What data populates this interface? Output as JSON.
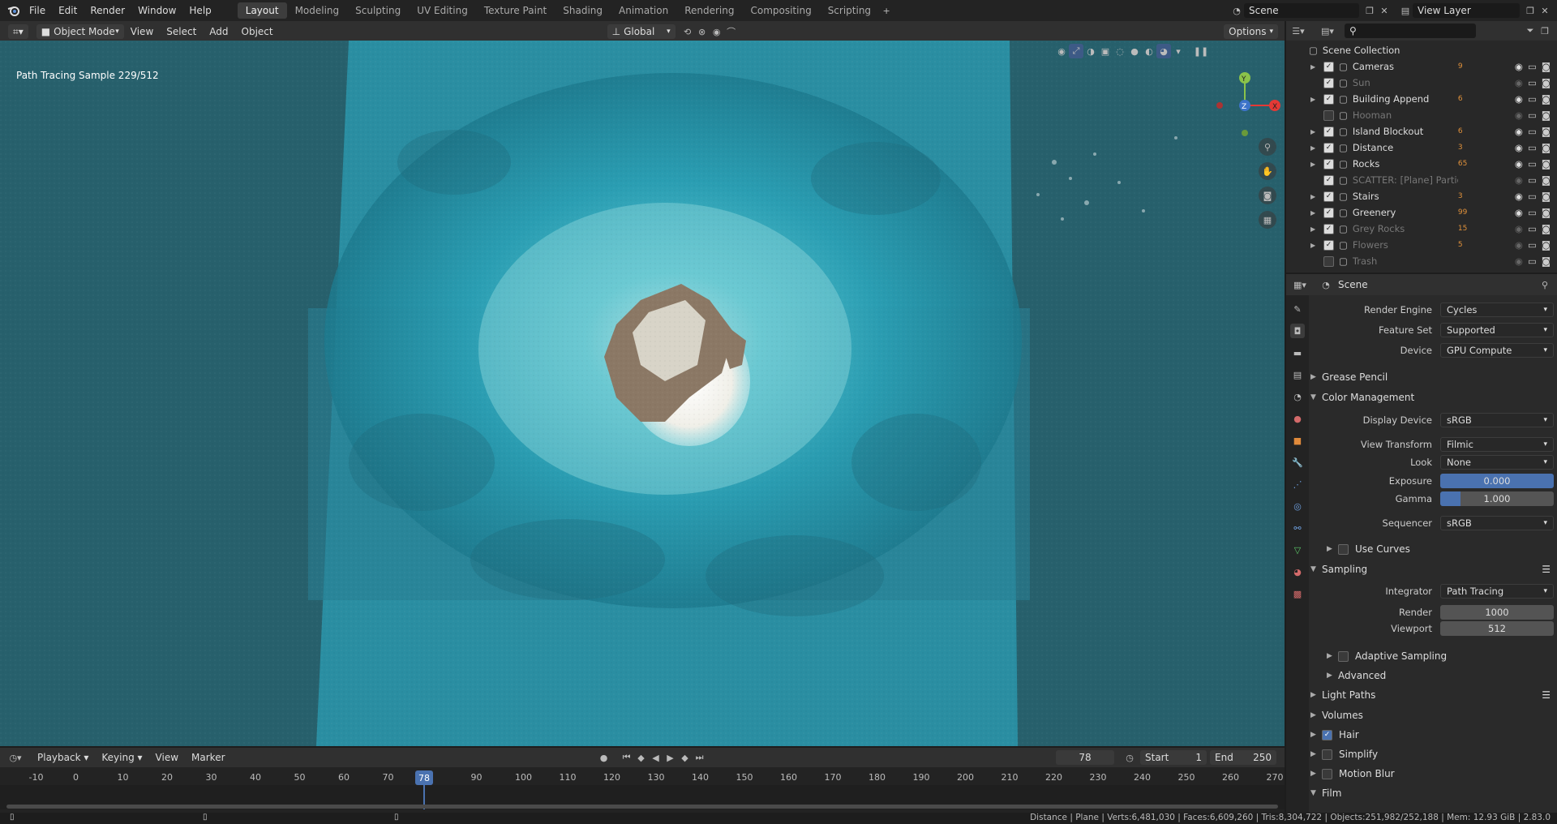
{
  "menu": [
    "File",
    "Edit",
    "Render",
    "Window",
    "Help"
  ],
  "workspaces": [
    "Layout",
    "Modeling",
    "Sculpting",
    "UV Editing",
    "Texture Paint",
    "Shading",
    "Animation",
    "Rendering",
    "Compositing",
    "Scripting"
  ],
  "active_workspace": "Layout",
  "scene_name": "Scene",
  "view_layer": "View Layer",
  "viewport": {
    "mode": "Object Mode",
    "menus": [
      "View",
      "Select",
      "Add",
      "Object"
    ],
    "transform_orientation": "Global",
    "options_label": "Options",
    "overlay_text": "Path Tracing Sample 229/512"
  },
  "outliner": {
    "root": "Scene Collection",
    "items": [
      {
        "name": "Cameras",
        "dim": false,
        "checked": true,
        "count": "9"
      },
      {
        "name": "Sun",
        "dim": true,
        "checked": true,
        "count": ""
      },
      {
        "name": "Building Append",
        "dim": false,
        "checked": true,
        "count": "6"
      },
      {
        "name": "Hooman",
        "dim": true,
        "checked": false,
        "count": ""
      },
      {
        "name": "Island Blockout",
        "dim": false,
        "checked": true,
        "count": "6"
      },
      {
        "name": "Distance",
        "dim": false,
        "checked": true,
        "count": "3"
      },
      {
        "name": "Rocks",
        "dim": false,
        "checked": true,
        "count": "65"
      },
      {
        "name": "SCATTER: [Plane] Particles",
        "dim": true,
        "checked": true,
        "count": ""
      },
      {
        "name": "Stairs",
        "dim": false,
        "checked": true,
        "count": "3"
      },
      {
        "name": "Greenery",
        "dim": false,
        "checked": true,
        "count": "99"
      },
      {
        "name": "Grey Rocks",
        "dim": true,
        "checked": true,
        "count": "15"
      },
      {
        "name": "Flowers",
        "dim": true,
        "checked": true,
        "count": "5"
      },
      {
        "name": "Trash",
        "dim": true,
        "checked": false,
        "count": ""
      }
    ]
  },
  "properties": {
    "context": "Scene",
    "render_engine": {
      "label": "Render Engine",
      "value": "Cycles"
    },
    "feature_set": {
      "label": "Feature Set",
      "value": "Supported"
    },
    "device": {
      "label": "Device",
      "value": "GPU Compute"
    },
    "grease_pencil": "Grease Pencil",
    "color_management": "Color Management",
    "display_device": {
      "label": "Display Device",
      "value": "sRGB"
    },
    "view_transform": {
      "label": "View Transform",
      "value": "Filmic"
    },
    "look": {
      "label": "Look",
      "value": "None"
    },
    "exposure": {
      "label": "Exposure",
      "value": "0.000"
    },
    "gamma": {
      "label": "Gamma",
      "value": "1.000"
    },
    "sequencer": {
      "label": "Sequencer",
      "value": "sRGB"
    },
    "use_curves": "Use Curves",
    "sampling": "Sampling",
    "integrator": {
      "label": "Integrator",
      "value": "Path Tracing"
    },
    "render": {
      "label": "Render",
      "value": "1000"
    },
    "viewport": {
      "label": "Viewport",
      "value": "512"
    },
    "adaptive_sampling": "Adaptive Sampling",
    "advanced": "Advanced",
    "light_paths": "Light Paths",
    "volumes": "Volumes",
    "hair": "Hair",
    "simplify": "Simplify",
    "motion_blur": "Motion Blur",
    "film": "Film"
  },
  "timeline": {
    "menus": [
      "Playback",
      "Keying",
      "View",
      "Marker"
    ],
    "current_frame": "78",
    "start_label": "Start",
    "start": "1",
    "end_label": "End",
    "end": "250",
    "ruler": [
      "-10",
      "0",
      "10",
      "20",
      "30",
      "40",
      "50",
      "60",
      "70",
      "90",
      "100",
      "110",
      "120",
      "130",
      "140",
      "150",
      "160",
      "170",
      "180",
      "190",
      "200",
      "210",
      "220",
      "230",
      "240",
      "250",
      "260",
      "270"
    ]
  },
  "status": "Distance | Plane | Verts:6,481,030 | Faces:6,609,260 | Tris:8,304,722 | Objects:251,982/252,188 | Mem: 12.93 GiB | 2.83.0"
}
